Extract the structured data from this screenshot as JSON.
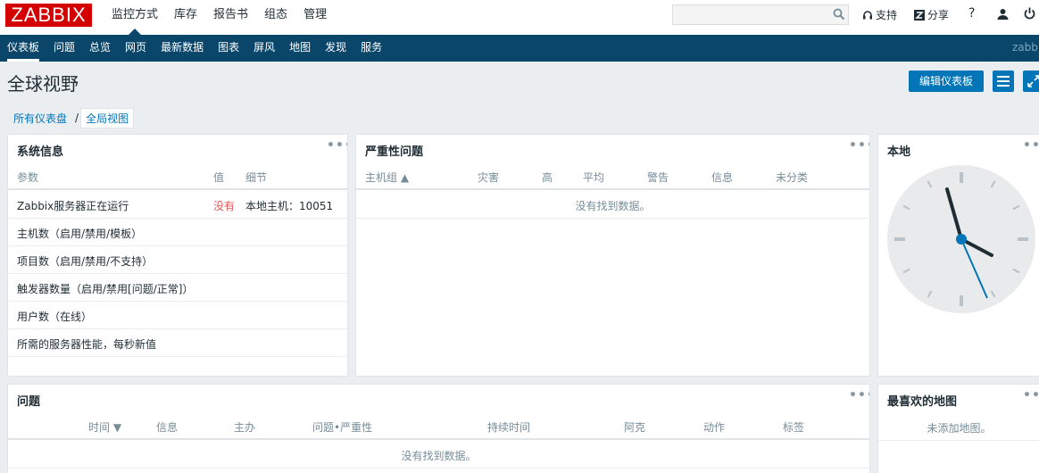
{
  "logo": "ZABBIX",
  "main_nav": [
    "监控方式",
    "库存",
    "报告书",
    "组态",
    "管理"
  ],
  "top_links": {
    "support": "支持",
    "share": "分享",
    "help": "?"
  },
  "sub_nav": [
    "仪表板",
    "问题",
    "总览",
    "网页",
    "最新数据",
    "图表",
    "屏风",
    "地图",
    "发现",
    "服务"
  ],
  "user_label": "zabbi",
  "page": {
    "title": "全球视野",
    "edit_button": "编辑仪表板"
  },
  "breadcrumb": {
    "parent": "所有仪表盘",
    "separator": "/",
    "current": "全局视图"
  },
  "widgets": {
    "dots": "•••",
    "system_info": {
      "title": "系统信息",
      "headers": [
        "参数",
        "值",
        "细节"
      ],
      "rows": [
        [
          "Zabbix服务器正在运行",
          "没有",
          "本地主机：10051"
        ],
        [
          "主机数（启用/禁用/模板）",
          "",
          ""
        ],
        [
          "项目数（启用/禁用/不支持）",
          "",
          ""
        ],
        [
          "触发器数量（启用/禁用[问题/正常]）",
          "",
          ""
        ],
        [
          "用户数（在线）",
          "",
          ""
        ],
        [
          "所需的服务器性能，每秒新值",
          "",
          ""
        ]
      ]
    },
    "severity": {
      "title": "严重性问题",
      "headers": [
        "主机组 ▲",
        "灾害",
        "高",
        "平均",
        "警告",
        "信息",
        "未分类"
      ],
      "no_data": "没有找到数据。"
    },
    "clock": {
      "title": "本地"
    },
    "problems": {
      "title": "问题",
      "headers": [
        "时间 ▼",
        "信息",
        "主办",
        "问题•严重性",
        "持续时间",
        "阿克",
        "动作",
        "标签"
      ],
      "no_data": "没有找到数据。"
    },
    "fav_maps": {
      "title": "最喜欢的地图",
      "no_data": "未添加地图。"
    }
  },
  "colors": {
    "nav_bg": "#0a466a",
    "accent": "#0275b8",
    "logo": "#d40000",
    "problem_red": "#e45959"
  }
}
